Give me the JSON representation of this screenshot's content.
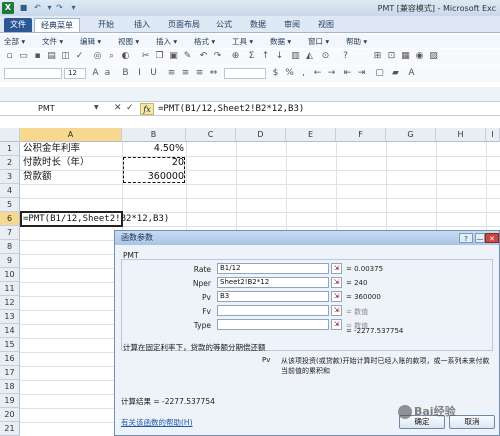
{
  "window": {
    "title": "PMT [兼容模式] - Microsoft Exc"
  },
  "quick_access": {
    "logo": "X"
  },
  "ribbon_tabs": [
    "文件",
    "经典菜单",
    "开始",
    "插入",
    "页面布局",
    "公式",
    "数据",
    "审阅",
    "视图"
  ],
  "ribbon_active_tab": "经典菜单",
  "classic_menus": [
    "全部 ▾",
    "文件 ▾",
    "编辑 ▾",
    "视图 ▾",
    "插入 ▾",
    "格式 ▾",
    "工具 ▾",
    "数据 ▾",
    "窗口 ▾",
    "帮助 ▾"
  ],
  "toolbar": {
    "font_size": "12"
  },
  "formula_bar": {
    "name_box": "PMT",
    "cancel": "✕",
    "enter": "✓",
    "fx": "fx",
    "formula": "=PMT(B1/12,Sheet2!B2*12,B3)"
  },
  "sheet": {
    "columns": [
      "A",
      "B",
      "C",
      "D",
      "E",
      "F",
      "G",
      "H",
      "I"
    ],
    "rows": [
      "1",
      "2",
      "3",
      "4",
      "5",
      "6",
      "7",
      "8",
      "9",
      "10",
      "11",
      "12",
      "13",
      "14",
      "15",
      "16",
      "17",
      "18",
      "19",
      "20",
      "21"
    ],
    "cells": {
      "A1": "公积金年利率",
      "B1": "4.50%",
      "A2": "付款时长（年）",
      "B2": "20",
      "A3": "贷款额",
      "B3": "360000",
      "A6": "=PMT(B1/12,Sheet2!B2*12,B3)"
    }
  },
  "dialog": {
    "title": "函数参数",
    "help_btn": "?",
    "min_btn": "—",
    "close_btn": "✕",
    "function_name": "PMT",
    "args": [
      {
        "label": "Rate",
        "value": "B1/12",
        "result": "= 0.00375",
        "muted": false
      },
      {
        "label": "Nper",
        "value": "Sheet2!B2*12",
        "result": "= 240",
        "muted": false
      },
      {
        "label": "Pv",
        "value": "B3",
        "result": "= 360000",
        "muted": false
      },
      {
        "label": "Fv",
        "value": "",
        "result": "= 数值",
        "muted": true
      },
      {
        "label": "Type",
        "value": "",
        "result": "= 数值",
        "muted": true
      }
    ],
    "formula_result_inline": "= -2277.537754",
    "description": "计算在固定利率下，贷款的等额分期偿还额",
    "pv_label": "Pv",
    "pv_description": "从该项投资(或贷款)开始计算时已经入账的款项，或一系列未来付款当前值的累积和",
    "calc_result": "计算结果 =  -2277.537754",
    "help_link": "有关该函数的帮助(H)",
    "ok": "确定",
    "cancel": "取消"
  },
  "watermark": "Bai经验"
}
